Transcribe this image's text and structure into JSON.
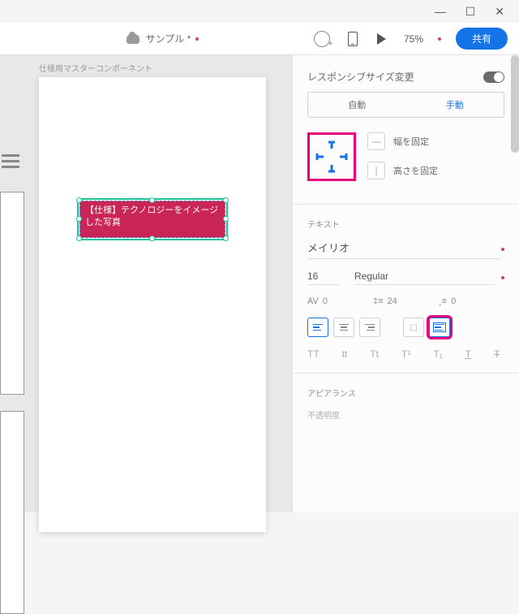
{
  "window": {
    "minimize": "—",
    "maximize": "☐",
    "close": "✕"
  },
  "toolbar": {
    "doc_title": "サンプル *",
    "zoom": "75%",
    "share": "共有"
  },
  "artboard": {
    "label": "仕様用マスターコンポーネント",
    "selected_text": "【仕様】テクノロジーをイメージした写真"
  },
  "panel": {
    "responsive": {
      "title": "レスポンシブサイズ変更",
      "auto": "自動",
      "manual": "手動",
      "fix_w": "幅を固定",
      "fix_h": "高さを固定"
    },
    "text": {
      "title": "テキスト",
      "font": "メイリオ",
      "size": "16",
      "weight": "Regular",
      "tracking": "0",
      "leading": "24",
      "paragraph": "0",
      "case_upper": "TT",
      "case_lower": "tt",
      "case_title": "Tt",
      "sup": "T¹",
      "sub": "T₁",
      "underline": "T",
      "strike": "T"
    },
    "appearance": {
      "title": "アピアランス",
      "opacity": "不透明度"
    }
  }
}
